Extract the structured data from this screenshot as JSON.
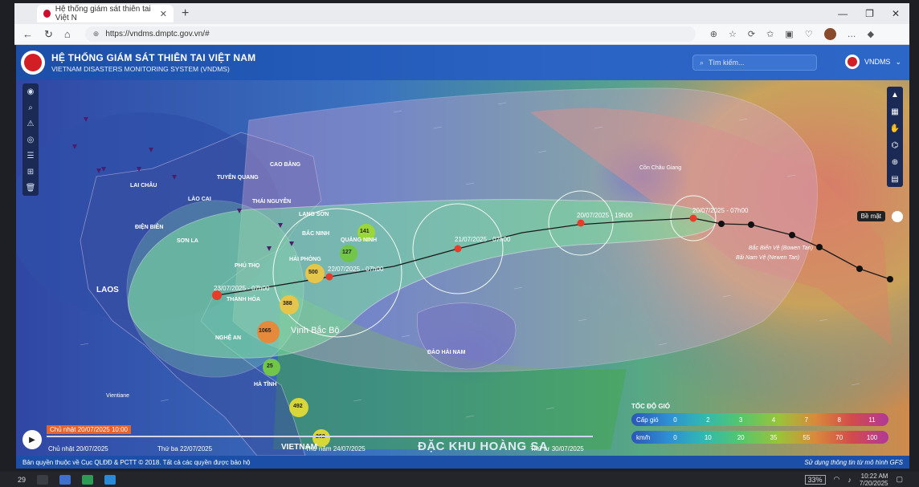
{
  "browser": {
    "tab_title": "Hệ thống giám sát thiên tai Việt N",
    "url": "https://vndms.dmptc.gov.vn/#",
    "new_tab": "+",
    "win_min": "—",
    "win_max": "❐",
    "win_close": "✕"
  },
  "header": {
    "title": "HỆ THỐNG GIÁM SÁT THIÊN TAI VIỆT NAM",
    "subtitle": "VIETNAM DISASTERS MONITORING SYSTEM (VNDMS)",
    "search_placeholder": "Tìm kiếm...",
    "user": "VNDMS"
  },
  "map": {
    "provinces": [
      "LAI CHÂU",
      "LÀO CAI",
      "TUYÊN QUANG",
      "CAO BẰNG",
      "THÁI NGUYÊN",
      "ĐIỆN BIÊN",
      "SƠN LA",
      "LẠNG SƠN",
      "BẮC NINH",
      "PHÚ THỌ",
      "HẢI PHÒNG",
      "THANH HÓA",
      "NGHỆ AN",
      "HÀ TĨNH",
      "QUẢNG NINH"
    ],
    "countries": [
      "LAOS",
      "Vientiane",
      "VIETNAM"
    ],
    "sea_labels": [
      "Vịnh Bắc Bộ",
      "ĐẢO HẢI NAM",
      "Cồn Châu Giang"
    ],
    "track_labels": [
      "23/07/2025 - 07h00",
      "22/07/2025 - 07h00",
      "21/07/2025 - 07h00",
      "20/07/2025 - 19h00",
      "20/07/2025 - 07h00"
    ],
    "clusters": [
      "141",
      "127",
      "500",
      "388",
      "1065",
      "25",
      "492",
      "262"
    ],
    "layer_label": "Bề mặt",
    "watermark": "ĐẶC KHU HOÀNG SA",
    "offshore_labels": [
      "Bắc Biển Vệ (Bowen Tan)",
      "Bãi Nam Vệ (Newen Tan)"
    ]
  },
  "timeline": {
    "current": "Chủ nhật 20/07/2025 10:00",
    "dates": [
      "Chủ nhật 20/07/2025",
      "Thứ ba 22/07/2025",
      "Thứ năm 24/07/2025",
      "Thứ tư 30/07/2025"
    ]
  },
  "wind_legend": {
    "title": "TỐC ĐỘ GIÓ",
    "row1_label": "Cấp gió",
    "row1": [
      "0",
      "2",
      "3",
      "4",
      "7",
      "8",
      "11"
    ],
    "row2_label": "km/h",
    "row2": [
      "0",
      "10",
      "20",
      "35",
      "55",
      "70",
      "100"
    ]
  },
  "footer": {
    "left": "Bản quyền thuộc về Cục QLĐĐ & PCTT © 2018. Tất cả các quyền được bảo hộ",
    "right": "Sử dụng thông tin từ mô hình GFS"
  },
  "taskbar": {
    "weather": "29",
    "battery": "33%",
    "time": "10:22 AM",
    "date": "7/20/2025"
  }
}
